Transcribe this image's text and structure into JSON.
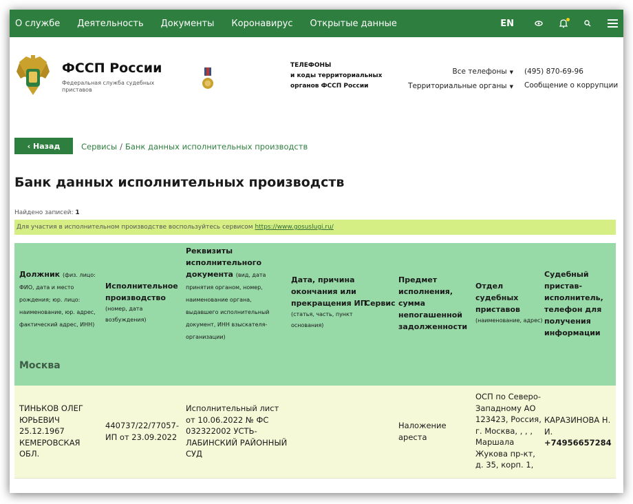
{
  "nav": {
    "items": [
      "О службе",
      "Деятельность",
      "Документы",
      "Коронавирус",
      "Открытые данные"
    ],
    "lang": "EN",
    "icons": [
      "eye-icon",
      "bell-icon",
      "search-icon",
      "menu-icon"
    ]
  },
  "header": {
    "title": "ФССП России",
    "subtitle": "Федеральная служба судебных приставов",
    "phones_line1": "ТЕЛЕФОНЫ",
    "phones_line2": "и коды территориальных",
    "phones_line3": "органов ФССП России",
    "all_phones": "Все телефоны",
    "territorial": "Территориальные органы",
    "phone": "(495) 870-69-96",
    "corruption": "Сообщение о коррупции"
  },
  "breadcrumb": {
    "back": "‹ Назад",
    "part1": "Сервисы",
    "separator": "/",
    "part2": "Банк данных исполнительных производств"
  },
  "page": {
    "title": "Банк данных исполнительных производств",
    "count_label": "Найдено записей:",
    "count_value": "1",
    "notice_text": "Для участия в исполнительном производстве воспользуйтесь сервисом ",
    "notice_link": "https://www.gosuslugi.ru/"
  },
  "table": {
    "headers": [
      {
        "title": "Должник",
        "note": "(физ. лицо: ФИО, дата и место рождения; юр. лицо: наименование, юр. адрес, фактический адрес, ИНН)"
      },
      {
        "title": "Исполнительное производство",
        "note": "(номер, дата возбуждения)"
      },
      {
        "title": "Реквизиты исполнительного документа",
        "note": "(вид, дата принятия органом, номер, наименование органа, выдавшего исполнительный документ, ИНН взыскателя-организации)"
      },
      {
        "title": "Дата, причина окончания или прекращения ИП",
        "note": "(статья, часть, пункт основания)"
      },
      {
        "title": "Сервис",
        "note": ""
      },
      {
        "title": "Предмет исполнения, сумма непогашенной задолженности",
        "note": ""
      },
      {
        "title": "Отдел судебных приставов",
        "note": "(наименование, адрес)"
      },
      {
        "title": "Судебный пристав-исполнитель, телефон для получения информации",
        "note": ""
      }
    ],
    "region": "Москва",
    "rows": [
      {
        "debtor": "ТИНЬКОВ ОЛЕГ ЮРЬЕВИЧ 25.12.1967 КЕМЕРОВСКАЯ ОБЛ.",
        "proceeding": "440737/22/77057-ИП от 23.09.2022",
        "document": "Исполнительный лист от 10.06.2022 № ФС 032322002 УСТЬ-ЛАБИНСКИЙ РАЙОННЫЙ СУД",
        "end_reason": "",
        "service": "",
        "subject": "Наложение ареста",
        "department": "ОСП по Северо-Западному АО 123423, Россия, г. Москва, , , , Маршала Жукова пр-кт, д. 35, корп. 1,",
        "bailiff_name": "КАРАЗИНОВА Н. И.",
        "bailiff_phone": "+74956657284"
      }
    ]
  },
  "colors": {
    "nav_green": "#2e7f3f",
    "table_header": "#97d9a7",
    "row_bg": "#f5f9d8",
    "notice_bg": "#d6ef84"
  }
}
